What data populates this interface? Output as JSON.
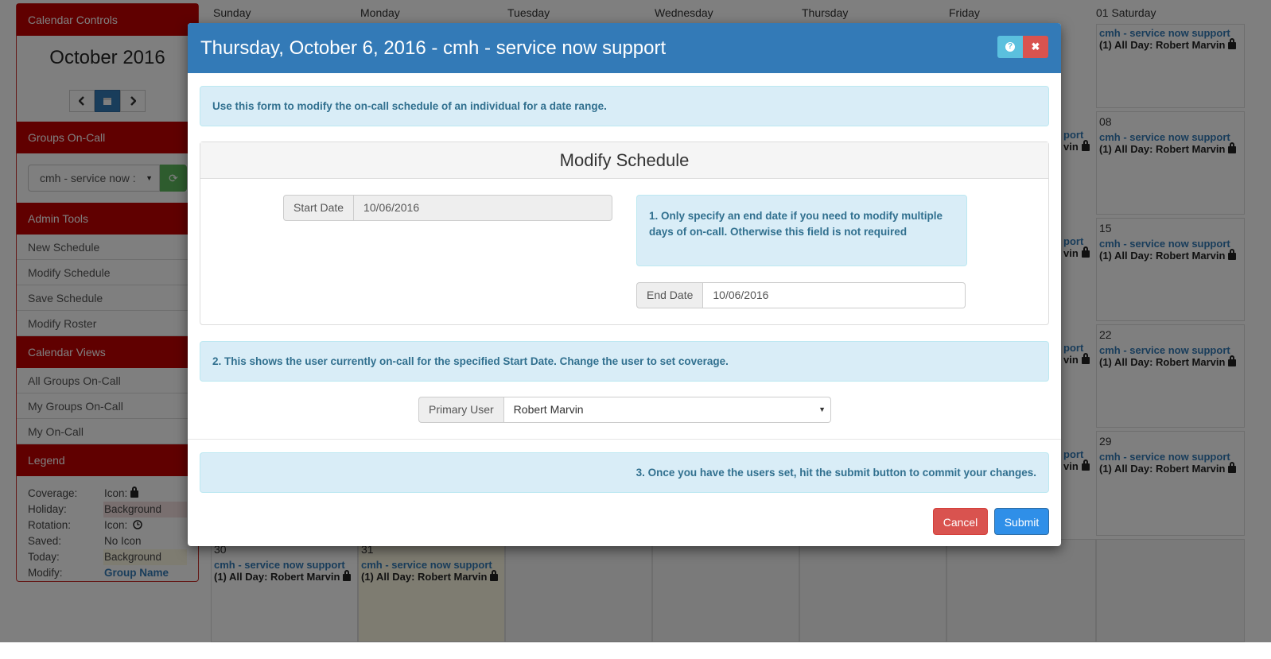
{
  "sidebar": {
    "calendar_controls": "Calendar Controls",
    "month": "October 2016",
    "groups_oncall": "Groups On-Call",
    "group_select_value": "cmh - service now :",
    "admin_tools": "Admin Tools",
    "admin_links": [
      "New Schedule",
      "Modify Schedule",
      "Save Schedule",
      "Modify Roster"
    ],
    "calendar_views": "Calendar Views",
    "view_links": [
      "All Groups On-Call",
      "My Groups On-Call",
      "My On-Call"
    ],
    "legend_title": "Legend",
    "legend": [
      {
        "key": "Coverage:",
        "value": "Icon:"
      },
      {
        "key": "Holiday:",
        "value": "Background"
      },
      {
        "key": "Rotation:",
        "value": "Icon:"
      },
      {
        "key": "Saved:",
        "value": "No Icon"
      },
      {
        "key": "Today:",
        "value": "Background"
      },
      {
        "key": "Modify:",
        "value": "Group Name"
      }
    ]
  },
  "calendar": {
    "days": [
      "Sunday",
      "Monday",
      "Tuesday",
      "Wednesday",
      "Thursday",
      "Friday",
      "01 Saturday"
    ],
    "saturday_dates": [
      "08",
      "15",
      "22",
      "29"
    ],
    "last_row_dates": [
      "30",
      "31"
    ],
    "event_title": "cmh - service now support",
    "event_title_partial": "port",
    "event_line": "(1) All Day: Robert Marvin",
    "event_line_partial": "vin"
  },
  "modal": {
    "title": "Thursday, October 6, 2016 - cmh - service now support",
    "help_icon": "?",
    "close_icon": "✖",
    "intro": "Use this form to modify the on-call schedule of an individual for a date range.",
    "panel_title": "Modify Schedule",
    "start_date_label": "Start Date",
    "start_date_value": "10/06/2016",
    "hint1": "1. Only specify an end date if you need to modify multiple days of on-call. Otherwise this field is not required",
    "end_date_label": "End Date",
    "end_date_value": "10/06/2016",
    "hint2": "2. This shows the user currently on-call for the specified Start Date. Change the user to set coverage.",
    "primary_user_label": "Primary User",
    "primary_user_value": "Robert Marvin",
    "hint3": "3. Once you have the users set, hit the submit button to commit your changes.",
    "cancel": "Cancel",
    "submit": "Submit"
  }
}
